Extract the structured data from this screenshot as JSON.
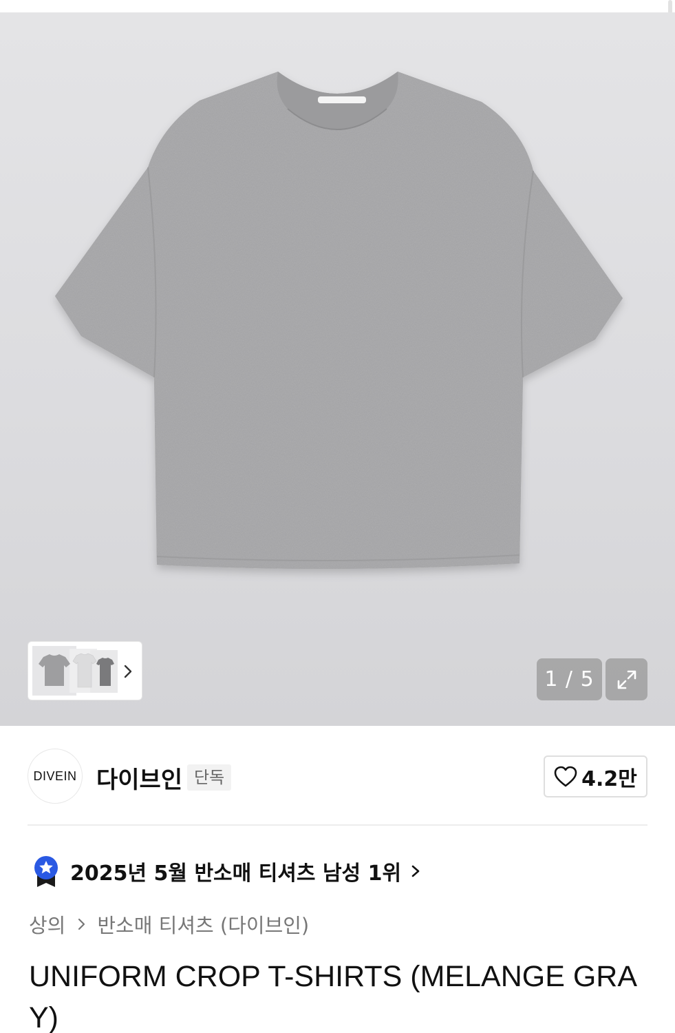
{
  "gallery": {
    "counter": "1 / 5",
    "current_index": 1,
    "total_images": 5,
    "product_image": "melange-gray-tshirt",
    "thumbnail_icons": [
      "tshirt-thumbnail-gray",
      "tshirt-thumbnail-white",
      "tshirt-thumbnail-charcoal"
    ],
    "expand_icon": "expand-icon",
    "next_icon": "chevron-right-icon"
  },
  "brand": {
    "logo_text": "DIVEIN",
    "name": "다이브인",
    "badge": "단독",
    "like_count": "4.2만",
    "like_icon": "heart-icon"
  },
  "ranking": {
    "icon": "ranking-badge-icon",
    "text": "2025년 5월 반소매 티셔츠 남성 1위"
  },
  "breadcrumb": {
    "category": "상의",
    "subcategory": "반소매 티셔츠 (다이브인)"
  },
  "product": {
    "title": "UNIFORM CROP T-SHIRTS (MELANGE GRAY)"
  },
  "colors": {
    "accent_blue": "#2a59e3",
    "ribbon_dark": "#1a1a1a",
    "shirt_gray": "#a6a6a8"
  }
}
